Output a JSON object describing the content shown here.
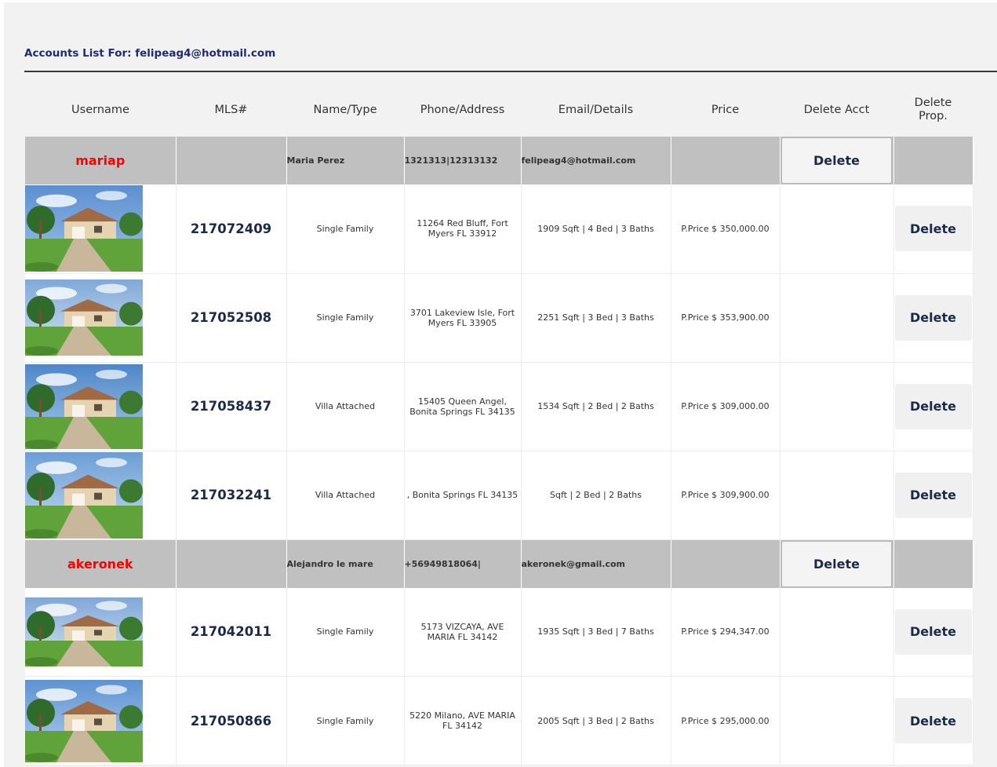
{
  "page": {
    "title": "Accounts List For: felipeag4@hotmail.com"
  },
  "columns": [
    "Username",
    "MLS#",
    "Name/Type",
    "Phone/Address",
    "Email/Details",
    "Price",
    "Delete Acct",
    "Delete\nProp."
  ],
  "accounts": [
    {
      "username": "mariap",
      "name": "Maria Perez",
      "phone": "1321313|12313132",
      "email": "felipeag4@hotmail.com",
      "delete_label": "Delete",
      "properties": [
        {
          "mls": "217072409",
          "type": "Single Family",
          "address": "11264 Red Bluff, Fort Myers FL 33912",
          "details": "1909 Sqft | 4 Bed | 3 Baths",
          "price": "P.Price $ 350,000.00",
          "delete_label": "Delete"
        },
        {
          "mls": "217052508",
          "type": "Single Family",
          "address": "3701 Lakeview Isle, Fort Myers FL 33905",
          "details": "2251 Sqft | 3 Bed | 3 Baths",
          "price": "P.Price $ 353,900.00",
          "delete_label": "Delete"
        },
        {
          "mls": "217058437",
          "type": "Villa Attached",
          "address": "15405 Queen Angel, Bonita Springs FL 34135",
          "details": "1534 Sqft | 2 Bed | 2 Baths",
          "price": "P.Price $ 309,000.00",
          "delete_label": "Delete"
        },
        {
          "mls": "217032241",
          "type": "Villa Attached",
          "address": ", Bonita Springs FL 34135",
          "details": "Sqft | 2 Bed | 2 Baths",
          "price": "P.Price $ 309,900.00",
          "delete_label": "Delete"
        }
      ]
    },
    {
      "username": "akeronek",
      "name": "Alejandro le mare",
      "phone": "+56949818064|",
      "email": "akeronek@gmail.com",
      "delete_label": "Delete",
      "properties": [
        {
          "mls": "217042011",
          "type": "Single Family",
          "address": "5173 VIZCAYA, AVE MARIA FL 34142",
          "details": "1935 Sqft | 3 Bed | 7 Baths",
          "price": "P.Price $ 294,347.00",
          "delete_label": "Delete"
        },
        {
          "mls": "217050866",
          "type": "Single Family",
          "address": "5220 Milano, AVE MARIA FL 34142",
          "details": "2005 Sqft | 3 Bed | 2 Baths",
          "price": "P.Price $ 295,000.00",
          "delete_label": "Delete"
        }
      ]
    }
  ]
}
